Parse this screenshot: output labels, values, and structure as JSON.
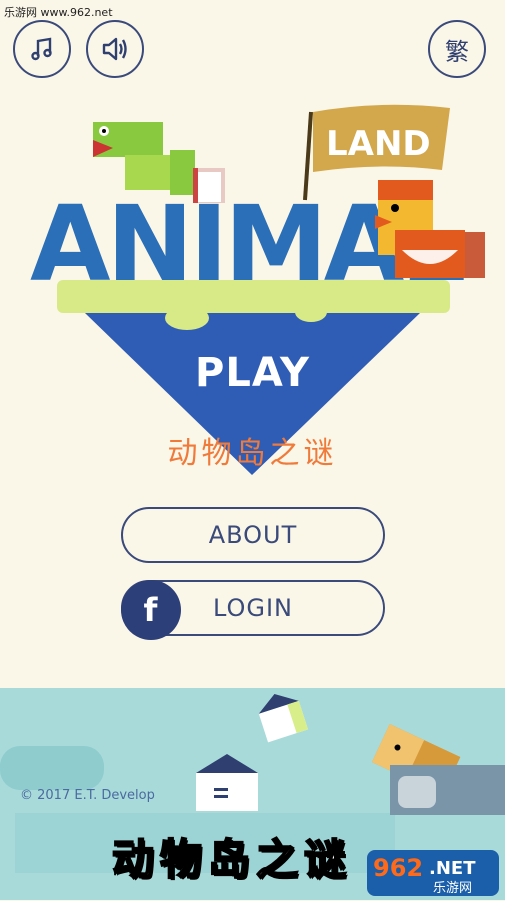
{
  "watermark": {
    "text": "乐游网 www.962.net"
  },
  "top_bar": {
    "music_icon": "music-note-icon",
    "sound_icon": "speaker-icon",
    "traditional_label": "繁"
  },
  "logo": {
    "word_main": "ANIMAL",
    "word_flag": "LAND"
  },
  "play": {
    "label": "PLAY"
  },
  "subtitle": {
    "text": "动物岛之谜"
  },
  "buttons": {
    "about_label": "ABOUT",
    "login_label": "LOGIN",
    "fb_icon_text": "f"
  },
  "footer": {
    "copyright": "© 2017 E.T. Develop",
    "bottom_title": "动物岛之谜"
  },
  "badge_962": {
    "main": "962",
    "dot_net": ".NET",
    "sub": "乐游网"
  },
  "colors": {
    "background": "#fbf7e8",
    "water": "#a9dada",
    "triangle": "#2f5db5",
    "accent_orange": "#f07a3a",
    "navy": "#3a4a7a"
  }
}
